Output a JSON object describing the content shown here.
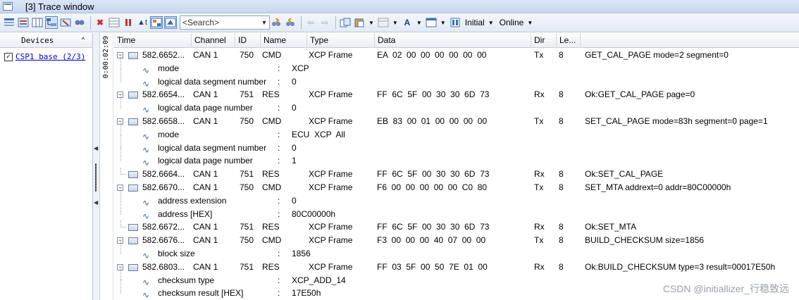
{
  "window": {
    "title": "[3] Trace window"
  },
  "toolbar": {
    "search_placeholder": "<Search>",
    "initial_label": "Initial",
    "online_label": "Online",
    "icons": [
      "filter-icon",
      "format-icon",
      "columns-icon",
      "tree-icon",
      "clear-icon",
      "find-icon",
      "delete-icon",
      "grid-icon",
      "pause-icon",
      "time-icon",
      "detail-view-icon",
      "highlight-icon",
      "search-next-icon",
      "search-prev-icon",
      "back-icon",
      "forward-icon",
      "copy-icon",
      "paste-icon",
      "layout-icon",
      "font-icon",
      "window-icon",
      "initial-icon"
    ]
  },
  "devices": {
    "header": "Devices",
    "items": [
      {
        "label": "CSP1 base (2/3)",
        "checked": "✓"
      }
    ]
  },
  "time_axis": {
    "label": "0:00:02:09"
  },
  "columns": [
    "Time",
    "Channel",
    "ID",
    "Name",
    "Type",
    "Data",
    "Dir",
    "Le..."
  ],
  "rows": [
    {
      "kind": "msg",
      "time": "582.6652...",
      "channel": "CAN 1",
      "id": "750",
      "name": "CMD",
      "type": "XCP Frame",
      "data": "EA  02  00  00  00  00  00  00",
      "dir": "Tx",
      "len": "8",
      "info": "GET_CAL_PAGE mode=2 segment=0"
    },
    {
      "kind": "sig",
      "name": "mode",
      "value": "XCP"
    },
    {
      "kind": "sig",
      "name": "logical data segment number",
      "value": "0"
    },
    {
      "kind": "msg",
      "time": "582.6654...",
      "channel": "CAN 1",
      "id": "751",
      "name": "RES",
      "type": "XCP Frame",
      "data": "FF  6C  5F  00  30  30  6D  73",
      "dir": "Rx",
      "len": "8",
      "info": "Ok:GET_CAL_PAGE page=0"
    },
    {
      "kind": "sig",
      "name": "logical data page number",
      "value": "0"
    },
    {
      "kind": "msg",
      "time": "582.6658...",
      "channel": "CAN 1",
      "id": "750",
      "name": "CMD",
      "type": "XCP Frame",
      "data": "EB  83  00  01  00  00  00  00",
      "dir": "Tx",
      "len": "8",
      "info": "SET_CAL_PAGE mode=83h segment=0 page=1"
    },
    {
      "kind": "sig",
      "name": "mode",
      "value": "ECU  XCP  All"
    },
    {
      "kind": "sig",
      "name": "logical data segment number",
      "value": "0"
    },
    {
      "kind": "sig",
      "name": "logical data page number",
      "value": "1"
    },
    {
      "kind": "msg",
      "leaf": true,
      "time": "582.6664...",
      "channel": "CAN 1",
      "id": "751",
      "name": "RES",
      "type": "XCP Frame",
      "data": "FF  6C  5F  00  30  30  6D  73",
      "dir": "Rx",
      "len": "8",
      "info": "Ok:SET_CAL_PAGE"
    },
    {
      "kind": "msg",
      "time": "582.6670...",
      "channel": "CAN 1",
      "id": "750",
      "name": "CMD",
      "type": "XCP Frame",
      "data": "F6  00  00  00  00  00  C0  80",
      "dir": "Tx",
      "len": "8",
      "info": "SET_MTA addrext=0 addr=80C00000h"
    },
    {
      "kind": "sig",
      "name": "address extension",
      "value": "0"
    },
    {
      "kind": "sig",
      "name": "address [HEX]",
      "value": "80C00000h"
    },
    {
      "kind": "msg",
      "leaf": true,
      "time": "582.6672...",
      "channel": "CAN 1",
      "id": "751",
      "name": "RES",
      "type": "XCP Frame",
      "data": "FF  6C  5F  00  30  30  6D  73",
      "dir": "Rx",
      "len": "8",
      "info": "Ok:SET_MTA"
    },
    {
      "kind": "msg",
      "time": "582.6676...",
      "channel": "CAN 1",
      "id": "750",
      "name": "CMD",
      "type": "XCP Frame",
      "data": "F3  00  00  00  40  07  00  00",
      "dir": "Tx",
      "len": "8",
      "info": "BUILD_CHECKSUM size=1856"
    },
    {
      "kind": "sig",
      "name": "block size",
      "value": "1856"
    },
    {
      "kind": "msg",
      "time": "582.6803...",
      "channel": "CAN 1",
      "id": "751",
      "name": "RES",
      "type": "XCP Frame",
      "data": "FF  03  5F  00  50  7E  01  00",
      "dir": "Rx",
      "len": "8",
      "info": "Ok:BUILD_CHECKSUM type=3 result=00017E50h"
    },
    {
      "kind": "sig",
      "name": "checksum type",
      "value": "XCP_ADD_14"
    },
    {
      "kind": "sig",
      "name": "checksum result [HEX]",
      "value": "17E50h"
    }
  ],
  "watermark": "CSDN @initiallizer_行稳致远"
}
